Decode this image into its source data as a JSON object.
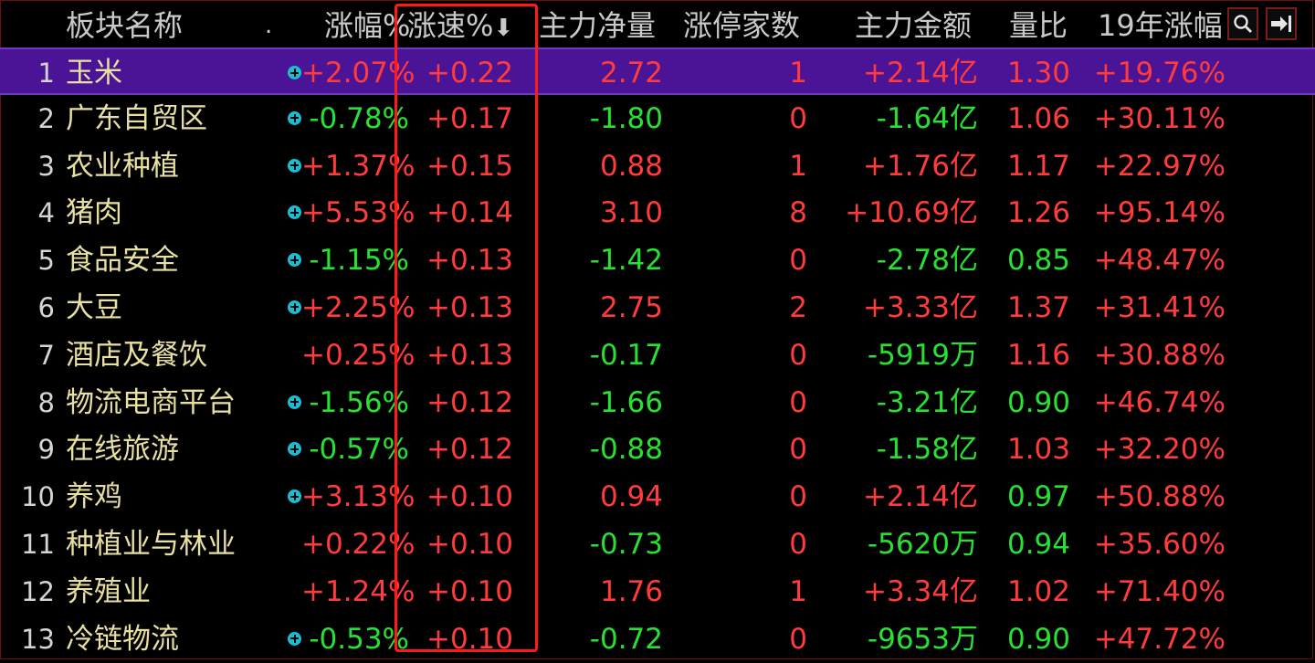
{
  "header": {
    "name": "板块名称",
    "dot": ".",
    "chg": "涨幅%",
    "speed": "涨速%",
    "sort_arrow": "⬇",
    "net": "主力净量",
    "limit_up": "涨停家数",
    "amount": "主力金额",
    "vol_ratio": "量比",
    "ytd": "19年涨幅",
    "search_icon": "search-icon",
    "exit_icon": "arrow-right-bar-icon"
  },
  "colors": {
    "up": "#ff3b3b",
    "down": "#28e032",
    "name": "#e8e0a0",
    "selected_bg": "#4b1496",
    "highlight_box": "#ff1a1a",
    "plus_icon": "#18bfd3"
  },
  "rows": [
    {
      "idx": "1",
      "name": "玉米",
      "plus": true,
      "chg": "+2.07%",
      "speed": "+0.22",
      "net": "2.72",
      "zt": "1",
      "amt": "+2.14亿",
      "vr": "1.30",
      "ytd": "+19.76%"
    },
    {
      "idx": "2",
      "name": "广东自贸区",
      "plus": true,
      "chg": "-0.78%",
      "speed": "+0.17",
      "net": "-1.80",
      "zt": "0",
      "amt": "-1.64亿",
      "vr": "1.06",
      "ytd": "+30.11%"
    },
    {
      "idx": "3",
      "name": "农业种植",
      "plus": true,
      "chg": "+1.37%",
      "speed": "+0.15",
      "net": "0.88",
      "zt": "1",
      "amt": "+1.76亿",
      "vr": "1.17",
      "ytd": "+22.97%"
    },
    {
      "idx": "4",
      "name": "猪肉",
      "plus": true,
      "chg": "+5.53%",
      "speed": "+0.14",
      "net": "3.10",
      "zt": "8",
      "amt": "+10.69亿",
      "vr": "1.26",
      "ytd": "+95.14%"
    },
    {
      "idx": "5",
      "name": "食品安全",
      "plus": true,
      "chg": "-1.15%",
      "speed": "+0.13",
      "net": "-1.42",
      "zt": "0",
      "amt": "-2.78亿",
      "vr": "0.85",
      "ytd": "+48.47%"
    },
    {
      "idx": "6",
      "name": "大豆",
      "plus": true,
      "chg": "+2.25%",
      "speed": "+0.13",
      "net": "2.75",
      "zt": "2",
      "amt": "+3.33亿",
      "vr": "1.37",
      "ytd": "+31.41%"
    },
    {
      "idx": "7",
      "name": "酒店及餐饮",
      "plus": false,
      "chg": "+0.25%",
      "speed": "+0.13",
      "net": "-0.17",
      "zt": "0",
      "amt": "-5919万",
      "vr": "1.16",
      "ytd": "+30.88%"
    },
    {
      "idx": "8",
      "name": "物流电商平台",
      "plus": true,
      "chg": "-1.56%",
      "speed": "+0.12",
      "net": "-1.66",
      "zt": "0",
      "amt": "-3.21亿",
      "vr": "0.90",
      "ytd": "+46.74%"
    },
    {
      "idx": "9",
      "name": "在线旅游",
      "plus": true,
      "chg": "-0.57%",
      "speed": "+0.12",
      "net": "-0.88",
      "zt": "0",
      "amt": "-1.58亿",
      "vr": "1.03",
      "ytd": "+32.20%"
    },
    {
      "idx": "10",
      "name": "养鸡",
      "plus": true,
      "chg": "+3.13%",
      "speed": "+0.10",
      "net": "0.94",
      "zt": "0",
      "amt": "+2.14亿",
      "vr": "0.97",
      "ytd": "+50.88%"
    },
    {
      "idx": "11",
      "name": "种植业与林业",
      "plus": false,
      "chg": "+0.22%",
      "speed": "+0.10",
      "net": "-0.73",
      "zt": "0",
      "amt": "-5620万",
      "vr": "0.94",
      "ytd": "+35.60%"
    },
    {
      "idx": "12",
      "name": "养殖业",
      "plus": false,
      "chg": "+1.24%",
      "speed": "+0.10",
      "net": "1.76",
      "zt": "1",
      "amt": "+3.34亿",
      "vr": "1.02",
      "ytd": "+71.40%"
    },
    {
      "idx": "13",
      "name": "冷链物流",
      "plus": true,
      "chg": "-0.53%",
      "speed": "+0.10",
      "net": "-0.72",
      "zt": "0",
      "amt": "-9653万",
      "vr": "0.90",
      "ytd": "+47.72%"
    }
  ]
}
